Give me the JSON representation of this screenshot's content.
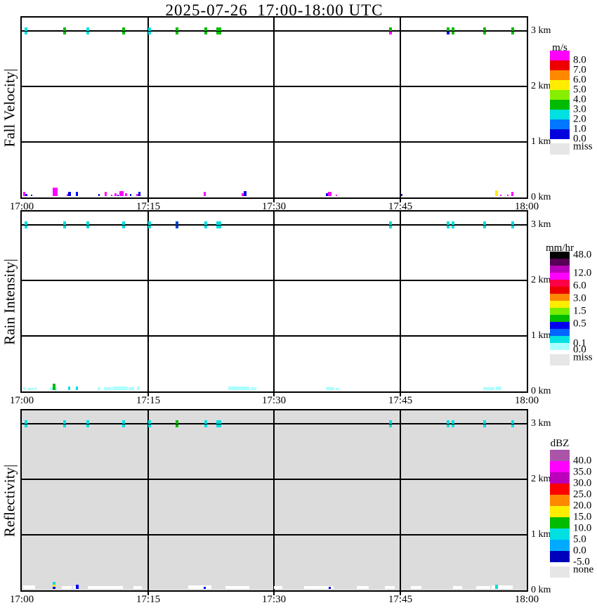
{
  "title": "2025-07-26  17:00-18:00 UTC",
  "axes": {
    "x_ticks": [
      "17:00",
      "17:15",
      "17:30",
      "17:45",
      "18:00"
    ],
    "y_right_labels": [
      "3 km",
      "2 km",
      "1 km",
      "0 km"
    ]
  },
  "chart_data": [
    {
      "type": "heatmap",
      "name": "Fall Velocity",
      "axis_label": "Fall Velocity|",
      "units": "m/s",
      "x_range": [
        "17:00",
        "18:00"
      ],
      "y_range_km": [
        0,
        3.2
      ],
      "grid": true,
      "background": "#ffffff",
      "legend": {
        "title": "m/s",
        "position": "right",
        "block_colors": [
          "#ff00ff",
          "#ee0000",
          "#ff8800",
          "#ffee00",
          "#88ee00",
          "#00bb00",
          "#00e0e0",
          "#0077ff",
          "#0000dd"
        ],
        "ticks": [
          {
            "label": "8.0",
            "at": 1
          },
          {
            "label": "7.0",
            "at": 2
          },
          {
            "label": "6.0",
            "at": 3
          },
          {
            "label": "5.0",
            "at": 4
          },
          {
            "label": "4.0",
            "at": 5
          },
          {
            "label": "3.0",
            "at": 6
          },
          {
            "label": "2.0",
            "at": 7
          },
          {
            "label": "1.0",
            "at": 8
          },
          {
            "label": "0.0",
            "at": 9
          }
        ],
        "miss": {
          "label": "miss",
          "color": "#e6e6e6"
        }
      },
      "marks_3km": [
        [
          4,
          4,
          "#00e0e0"
        ],
        [
          59,
          4,
          "#00bb00"
        ],
        [
          92,
          4,
          "#00e0e0"
        ],
        [
          143,
          4,
          "#00bb00"
        ],
        [
          180,
          4,
          "#00e0e0"
        ],
        [
          219,
          4,
          "#00bb00"
        ],
        [
          260,
          4,
          "#00bb00"
        ],
        [
          277,
          7,
          "#00bb00"
        ],
        [
          523,
          4,
          "#00bb00",
          "#ff00ff"
        ],
        [
          605,
          4,
          "#00bb00",
          "#0000ee"
        ],
        [
          612,
          4,
          "#00bb00"
        ],
        [
          657,
          4,
          "#00bb00"
        ],
        [
          697,
          4,
          "#00bb00"
        ]
      ],
      "marks_0km": [
        [
          2,
          3,
          6,
          "#ff00ff"
        ],
        [
          5,
          3,
          3,
          "#0000ee"
        ],
        [
          13,
          2,
          2,
          "#0000ee"
        ],
        [
          44,
          7,
          12,
          "#ff00ff"
        ],
        [
          64,
          3,
          3,
          "#ff00ff"
        ],
        [
          66,
          4,
          6,
          "#0000ee"
        ],
        [
          77,
          3,
          6,
          "#0000ee"
        ],
        [
          109,
          2,
          3,
          "#0000ee"
        ],
        [
          118,
          3,
          6,
          "#ff00ff"
        ],
        [
          127,
          2,
          2,
          "#ff00ff"
        ],
        [
          132,
          3,
          4,
          "#ff00ff"
        ],
        [
          136,
          2,
          2,
          "#0000ee"
        ],
        [
          139,
          6,
          7,
          "#ff00ff"
        ],
        [
          147,
          3,
          4,
          "#ff00ff"
        ],
        [
          154,
          2,
          3,
          "#0000ee"
        ],
        [
          163,
          3,
          3,
          "#ff00ff"
        ],
        [
          166,
          3,
          6,
          "#0000ee"
        ],
        [
          259,
          3,
          6,
          "#ff00ff"
        ],
        [
          313,
          5,
          4,
          "#ff00ff"
        ],
        [
          316,
          4,
          7,
          "#0000ee"
        ],
        [
          433,
          5,
          4,
          "#0000ee"
        ],
        [
          436,
          5,
          6,
          "#ff00ff"
        ],
        [
          447,
          2,
          2,
          "#ff00ff"
        ],
        [
          540,
          2,
          3,
          "#0000ee"
        ],
        [
          674,
          4,
          8,
          "#ffee00"
        ],
        [
          681,
          2,
          2,
          "#ff00ff"
        ],
        [
          691,
          2,
          2,
          "#ff00ff"
        ],
        [
          697,
          3,
          6,
          "#ff00ff"
        ]
      ]
    },
    {
      "type": "heatmap",
      "name": "Rain Intensity",
      "axis_label": "Rain Intensity|",
      "units": "mm/hr",
      "x_range": [
        "17:00",
        "18:00"
      ],
      "y_range_km": [
        0,
        3.2
      ],
      "grid": true,
      "background": "#ffffff",
      "legend": {
        "title": "mm/hr",
        "position": "right",
        "block_colors": [
          "#000000",
          "#550055",
          "#bb00bb",
          "#ff00ff",
          "#ff0044",
          "#ee0000",
          "#ff8800",
          "#ffee00",
          "#77ee00",
          "#00bb00",
          "#0000ee",
          "#0066ff",
          "#00e0e0",
          "#aaffff"
        ],
        "ticks": [
          {
            "label": "48.0",
            "at": 0.5
          },
          {
            "label": "12.0",
            "at": 3.1
          },
          {
            "label": "6.0",
            "at": 4.9
          },
          {
            "label": "3.0",
            "at": 6.7
          },
          {
            "label": "1.5",
            "at": 8.5
          },
          {
            "label": "0.5",
            "at": 10.3
          },
          {
            "label": "0.1",
            "at": 13.1
          },
          {
            "label": "0.0",
            "at": 14.0
          }
        ],
        "miss": {
          "label": "miss",
          "color": "#e6e6e6"
        }
      },
      "marks_3km": [
        [
          4,
          4,
          "#00e0e0"
        ],
        [
          59,
          4,
          "#00e0e0"
        ],
        [
          92,
          4,
          "#00e0e0"
        ],
        [
          143,
          4,
          "#00e0e0"
        ],
        [
          180,
          4,
          "#00e0e0"
        ],
        [
          219,
          4,
          "#0044dd"
        ],
        [
          260,
          4,
          "#00e0e0"
        ],
        [
          277,
          7,
          "#00e0e0"
        ],
        [
          523,
          4,
          "#00e0e0"
        ],
        [
          605,
          4,
          "#00e0e0"
        ],
        [
          612,
          4,
          "#00e0e0"
        ],
        [
          657,
          4,
          "#00e0e0"
        ],
        [
          697,
          4,
          "#00e0e0"
        ]
      ],
      "marks_0km": [
        [
          2,
          4,
          4,
          "#aaffff"
        ],
        [
          8,
          9,
          3,
          "#aaffff"
        ],
        [
          18,
          3,
          4,
          "#aaffff"
        ],
        [
          40,
          10,
          4,
          "#aaffff"
        ],
        [
          44,
          4,
          9,
          "#00bb00"
        ],
        [
          66,
          3,
          5,
          "#00e0e0"
        ],
        [
          77,
          3,
          5,
          "#00e0e0"
        ],
        [
          108,
          4,
          4,
          "#aaffff"
        ],
        [
          117,
          10,
          4,
          "#aaffff"
        ],
        [
          129,
          22,
          5,
          "#aaffff"
        ],
        [
          152,
          8,
          4,
          "#aaffff"
        ],
        [
          164,
          4,
          5,
          "#aaffff"
        ],
        [
          294,
          30,
          5,
          "#aaffff"
        ],
        [
          326,
          8,
          4,
          "#aaffff"
        ],
        [
          433,
          12,
          4,
          "#aaffff"
        ],
        [
          447,
          5,
          3,
          "#aaffff"
        ],
        [
          657,
          16,
          4,
          "#aaffff"
        ],
        [
          675,
          8,
          5,
          "#aaffff"
        ]
      ]
    },
    {
      "type": "heatmap",
      "name": "Reflectivity",
      "axis_label": "Reflectivity|",
      "units": "dBZ",
      "x_range": [
        "17:00",
        "18:00"
      ],
      "y_range_km": [
        0,
        3.2
      ],
      "grid": true,
      "background": "#dcdcdc",
      "legend": {
        "title": "dBZ",
        "position": "right",
        "block_colors": [
          "#aa55aa",
          "#ff00ff",
          "#bb00bb",
          "#ff0000",
          "#ff8800",
          "#ffee00",
          "#00bb00",
          "#00e0e0",
          "#00aaff",
          "#0000bb"
        ],
        "ticks": [
          {
            "label": "40.0",
            "at": 1
          },
          {
            "label": "35.0",
            "at": 2
          },
          {
            "label": "30.0",
            "at": 3
          },
          {
            "label": "25.0",
            "at": 4
          },
          {
            "label": "20.0",
            "at": 5
          },
          {
            "label": "15.0",
            "at": 6
          },
          {
            "label": "10.0",
            "at": 7
          },
          {
            "label": "5.0",
            "at": 8
          },
          {
            "label": "0.0",
            "at": 9
          },
          {
            "label": "-5.0",
            "at": 10
          }
        ],
        "miss": {
          "label": "none",
          "color": "#e6e6e6"
        }
      },
      "marks_3km": [
        [
          4,
          4,
          "#00e0e0"
        ],
        [
          59,
          4,
          "#00e0e0"
        ],
        [
          92,
          4,
          "#00e0e0"
        ],
        [
          143,
          4,
          "#00e0e0"
        ],
        [
          180,
          4,
          "#00e0e0"
        ],
        [
          219,
          4,
          "#00bb00"
        ],
        [
          260,
          4,
          "#00e0e0"
        ],
        [
          277,
          7,
          "#00e0e0"
        ],
        [
          523,
          4,
          "#00e0e0"
        ],
        [
          605,
          4,
          "#00e0e0"
        ],
        [
          612,
          4,
          "#00e0e0"
        ],
        [
          657,
          4,
          "#00e0e0"
        ],
        [
          697,
          4,
          "#00e0e0"
        ]
      ],
      "marks_0km": [
        [
          2,
          17,
          5,
          "#ffffff"
        ],
        [
          44,
          4,
          10,
          "#ffee00"
        ],
        [
          44,
          4,
          3,
          "#0000ee"
        ],
        [
          44,
          4,
          4,
          "#00e0e0",
          6
        ],
        [
          57,
          14,
          4,
          "#ffffff"
        ],
        [
          73,
          8,
          4,
          "#ffffff"
        ],
        [
          77,
          4,
          6,
          "#0000ee"
        ],
        [
          94,
          50,
          4,
          "#ffffff"
        ],
        [
          159,
          12,
          4,
          "#ffffff"
        ],
        [
          237,
          33,
          5,
          "#ffffff"
        ],
        [
          259,
          3,
          3,
          "#0000ee"
        ],
        [
          290,
          34,
          4,
          "#ffffff"
        ],
        [
          359,
          12,
          4,
          "#ffffff"
        ],
        [
          402,
          42,
          4,
          "#ffffff"
        ],
        [
          437,
          3,
          3,
          "#0000ee"
        ],
        [
          477,
          17,
          4,
          "#ffffff"
        ],
        [
          517,
          14,
          4,
          "#ffffff"
        ],
        [
          554,
          15,
          4,
          "#ffffff"
        ],
        [
          614,
          13,
          4,
          "#ffffff"
        ],
        [
          647,
          20,
          4,
          "#ffffff"
        ],
        [
          669,
          30,
          5,
          "#ffffff"
        ],
        [
          674,
          4,
          6,
          "#00e0e0"
        ]
      ]
    }
  ]
}
